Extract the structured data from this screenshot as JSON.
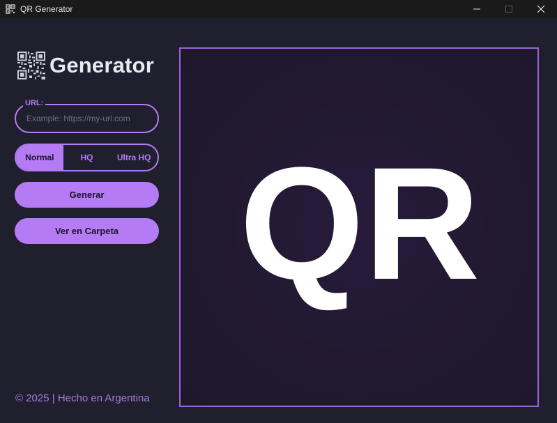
{
  "window": {
    "title": "QR Generator",
    "icon": "qr-icon",
    "controls": [
      "minimize-icon",
      "maximize-icon",
      "close-icon"
    ]
  },
  "sidebar": {
    "brand_title": "Generator",
    "brand_icon": "qr-code-icon",
    "url": {
      "label": "URL:",
      "placeholder": "Example: https://my-url.com",
      "value": ""
    },
    "quality": {
      "options": [
        "Normal",
        "HQ",
        "Ultra HQ"
      ],
      "selected": "Normal"
    },
    "generate_label": "Generar",
    "open_folder_label": "Ver en Carpeta",
    "footer": "© 2025 | Hecho en Argentina"
  },
  "preview": {
    "placeholder_text": "QR"
  },
  "colors": {
    "background": "#1f1f2e",
    "titlebar": "#1a1a1a",
    "accent": "#b57bf5",
    "preview_border": "#9a63d6",
    "preview_bg": "#21192f",
    "footer_text": "#a57cdb"
  }
}
